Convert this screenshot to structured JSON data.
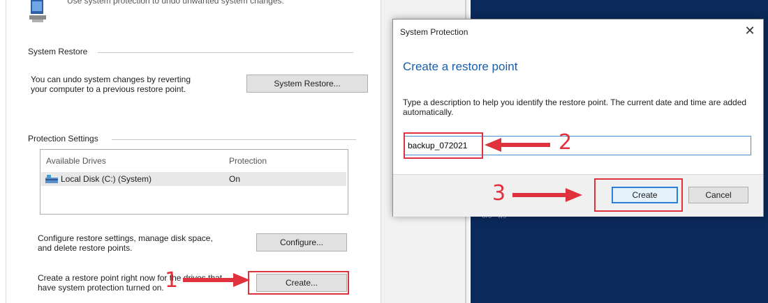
{
  "window": {
    "header_text": "Use system protection to undo unwanted system changes."
  },
  "system_restore": {
    "title": "System Restore",
    "description_line1": "You can undo system changes by reverting",
    "description_line2": "your computer to a previous restore point.",
    "button_label": "System Restore..."
  },
  "protection_settings": {
    "title": "Protection Settings",
    "columns": [
      "Available Drives",
      "Protection"
    ],
    "drives": [
      {
        "name": "Local Disk (C:) (System)",
        "protection": "On",
        "icon": "hard-drive-icon"
      }
    ],
    "configure_text_line1": "Configure restore settings, manage disk space,",
    "configure_text_line2": "and delete restore points.",
    "configure_button": "Configure...",
    "create_text_line1": "Create a restore point right now for the drives that",
    "create_text_line2": "have system protection turned on.",
    "create_button": "Create..."
  },
  "dialog": {
    "title": "System Protection",
    "heading": "Create a restore point",
    "description": "Type a description to help you identify the restore point. The current date and time are added automatically.",
    "input_value": "backup_072021",
    "create_button": "Create",
    "cancel_button": "Cancel"
  },
  "annotations": {
    "step1": "1",
    "step2": "2",
    "step3": "3",
    "color": "#e0323c"
  },
  "background": {
    "caption": "ors - ws"
  },
  "colors": {
    "accent": "#1a5ea8",
    "desktop": "#0b2a5a",
    "annotation": "#e0323c"
  }
}
